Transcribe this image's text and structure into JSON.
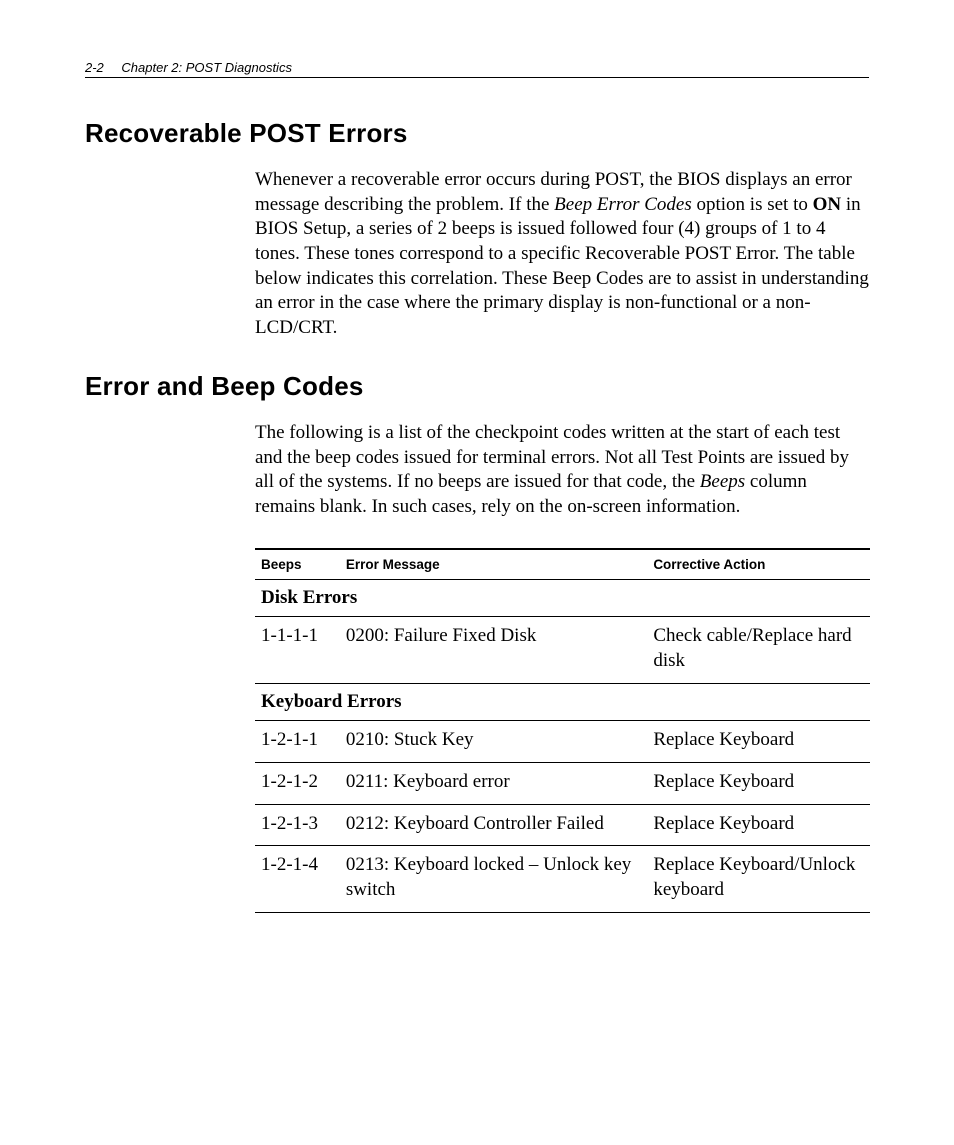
{
  "header": {
    "page_number": "2-2",
    "chapter_label": "Chapter 2:  POST Diagnostics"
  },
  "sections": {
    "recoverable": {
      "title": "Recoverable POST Errors",
      "para_parts": {
        "t1": "Whenever a recoverable error occurs during POST, the BIOS displays an error message describing the problem. If the ",
        "em1": "Beep Error Codes",
        "t2": " option is set to ",
        "b1": "ON",
        "t3": " in BIOS Setup, a series of 2 beeps is issued followed four (4) groups of 1 to 4 tones. These tones correspond to a specific Recoverable POST Error. The table below indicates this correlation. These Beep Codes are to assist in understanding an error in the case where the primary display is non-functional or a non-LCD/CRT."
      }
    },
    "codes": {
      "title": "Error and Beep Codes",
      "para_parts": {
        "t1": "The following is a list of the checkpoint codes written at the start of each test and the beep codes issued for terminal errors. Not all Test Points are issued by all of the systems. If no beeps are issued for that code, the ",
        "em1": "Beeps",
        "t2": " column remains blank. In such cases, rely on the on-screen information."
      }
    }
  },
  "table": {
    "headers": {
      "beeps": "Beeps",
      "message": "Error Message",
      "action": "Corrective Action"
    },
    "groups": [
      {
        "category": "Disk Errors",
        "rows": [
          {
            "beeps": "1-1-1-1",
            "message": "0200: Failure Fixed Disk",
            "action": "Check cable/Replace hard disk"
          }
        ]
      },
      {
        "category": "Keyboard Errors",
        "rows": [
          {
            "beeps": "1-2-1-1",
            "message": "0210: Stuck Key",
            "action": "Replace Keyboard"
          },
          {
            "beeps": "1-2-1-2",
            "message": "0211: Keyboard error",
            "action": "Replace Keyboard"
          },
          {
            "beeps": "1-2-1-3",
            "message": "0212: Keyboard Controller Failed",
            "action": "Replace Keyboard"
          },
          {
            "beeps": "1-2-1-4",
            "message": "0213: Keyboard locked – Unlock key switch",
            "action": "Replace Keyboard/Unlock keyboard"
          }
        ]
      }
    ]
  }
}
